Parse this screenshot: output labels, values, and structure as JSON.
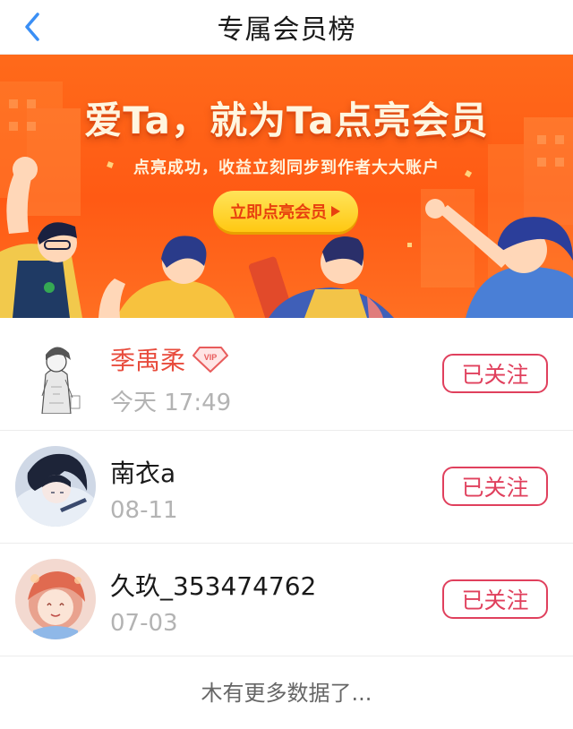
{
  "header": {
    "title": "专属会员榜",
    "back_icon": "chevron-left-icon"
  },
  "banner": {
    "headline": "爱Ta，就为Ta点亮会员",
    "subtitle": "点亮成功，收益立刻同步到作者大大账户",
    "cta_label": "立即点亮会员",
    "colors": {
      "background": "#ff5a14",
      "cta": "#ffd12a",
      "cta_text": "#e8400f"
    }
  },
  "members": [
    {
      "name": "季禹柔",
      "vip": true,
      "time": "今天 17:49",
      "follow_label": "已关注"
    },
    {
      "name": "南衣a",
      "vip": false,
      "time": "08-11",
      "follow_label": "已关注"
    },
    {
      "name": "久玖_353474762",
      "vip": false,
      "time": "07-03",
      "follow_label": "已关注"
    }
  ],
  "footer": {
    "text": "木有更多数据了..."
  },
  "colors": {
    "accent": "#e0405d",
    "vip_name": "#e84c3d",
    "nav_icon": "#3a8ff5",
    "muted": "#b3b3b3"
  }
}
